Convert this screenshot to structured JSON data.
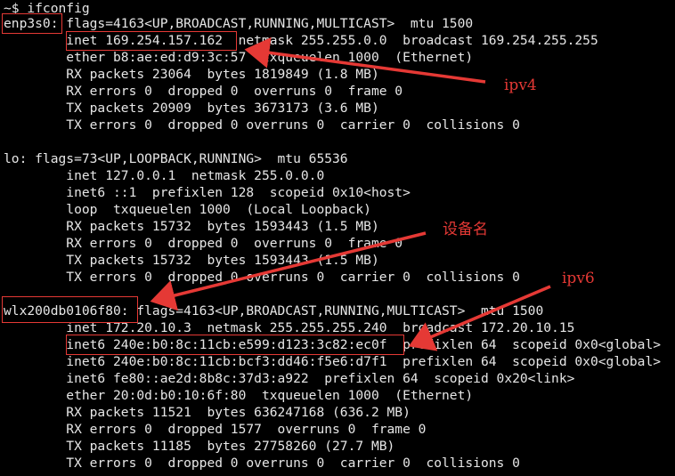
{
  "terminal": {
    "lines": [
      "~$ ifconfig",
      "enp3s0: flags=4163<UP,BROADCAST,RUNNING,MULTICAST>  mtu 1500",
      "        inet 169.254.157.162  netmask 255.255.0.0  broadcast 169.254.255.255",
      "        ether b8:ae:ed:d9:3c:57  txqueuelen 1000  (Ethernet)",
      "        RX packets 23064  bytes 1819849 (1.8 MB)",
      "        RX errors 0  dropped 0  overruns 0  frame 0",
      "        TX packets 20909  bytes 3673173 (3.6 MB)",
      "        TX errors 0  dropped 0 overruns 0  carrier 0  collisions 0",
      "",
      "lo: flags=73<UP,LOOPBACK,RUNNING>  mtu 65536",
      "        inet 127.0.0.1  netmask 255.0.0.0",
      "        inet6 ::1  prefixlen 128  scopeid 0x10<host>",
      "        loop  txqueuelen 1000  (Local Loopback)",
      "        RX packets 15732  bytes 1593443 (1.5 MB)",
      "        RX errors 0  dropped 0  overruns 0  frame 0",
      "        TX packets 15732  bytes 1593443 (1.5 MB)",
      "        TX errors 0  dropped 0 overruns 0  carrier 0  collisions 0",
      "",
      "wlx200db0106f80: flags=4163<UP,BROADCAST,RUNNING,MULTICAST>  mtu 1500",
      "        inet 172.20.10.3  netmask 255.255.255.240  broadcast 172.20.10.15",
      "        inet6 240e:b0:8c:11cb:e599:d123:3c82:ec0f  prefixlen 64  scopeid 0x0<global>",
      "        inet6 240e:b0:8c:11cb:bcf3:dd46:f5e6:d7f1  prefixlen 64  scopeid 0x0<global>",
      "        inet6 fe80::ae2d:8b8c:37d3:a922  prefixlen 64  scopeid 0x20<link>",
      "        ether 20:0d:b0:10:6f:80  txqueuelen 1000  (Ethernet)",
      "        RX packets 11521  bytes 636247168 (636.2 MB)",
      "        RX errors 0  dropped 1577  overruns 0  frame 0",
      "        TX packets 11185  bytes 27758260 (27.7 MB)",
      "        TX errors 0  dropped 0 overruns 0  carrier 0  collisions 0"
    ]
  },
  "annotations": {
    "ipv4": "ipv4",
    "device_name": "设备名",
    "ipv6": "ipv6"
  },
  "colors": {
    "background": "#000000",
    "text": "#e6e6e6",
    "annotation": "#e53935"
  }
}
